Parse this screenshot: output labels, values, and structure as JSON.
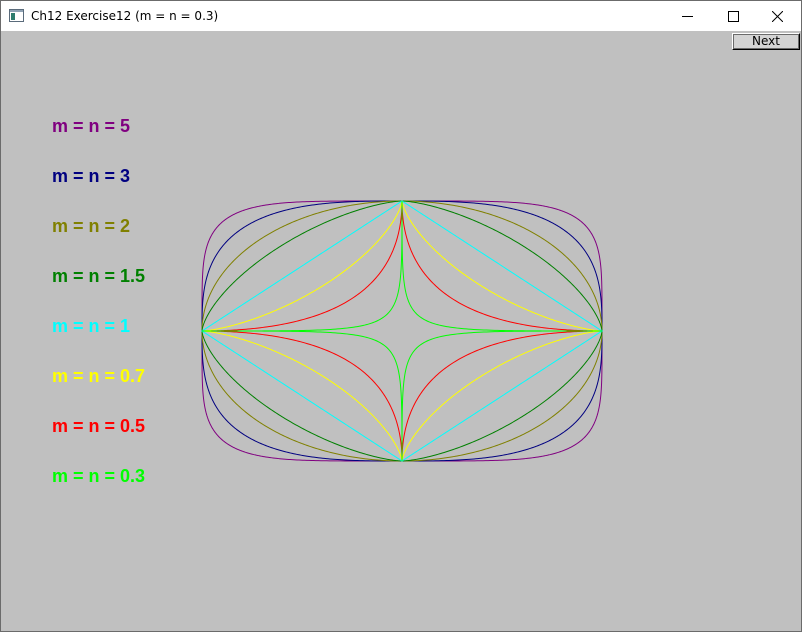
{
  "window": {
    "title": "Ch12 Exercise12 (m = n = 0.3)",
    "icon": "app-window-icon",
    "controls": [
      "minimize-icon",
      "maximize-icon",
      "close-icon"
    ]
  },
  "toolbar": {
    "next_label": "Next"
  },
  "colors": {
    "background": "#c0c0c0"
  },
  "superellipses": [
    {
      "label": "m = n = 5",
      "exponent": 5,
      "color": "#800080"
    },
    {
      "label": "m = n = 3",
      "exponent": 3,
      "color": "#000080"
    },
    {
      "label": "m = n = 2",
      "exponent": 2,
      "color": "#808000"
    },
    {
      "label": "m = n = 1.5",
      "exponent": 1.5,
      "color": "#008000"
    },
    {
      "label": "m = n = 1",
      "exponent": 1,
      "color": "#00ffff"
    },
    {
      "label": "m = n = 0.7",
      "exponent": 0.7,
      "color": "#ffff00"
    },
    {
      "label": "m = n = 0.5",
      "exponent": 0.5,
      "color": "#ff0000"
    },
    {
      "label": "m = n = 0.3",
      "exponent": 0.3,
      "color": "#00ff00"
    }
  ]
}
